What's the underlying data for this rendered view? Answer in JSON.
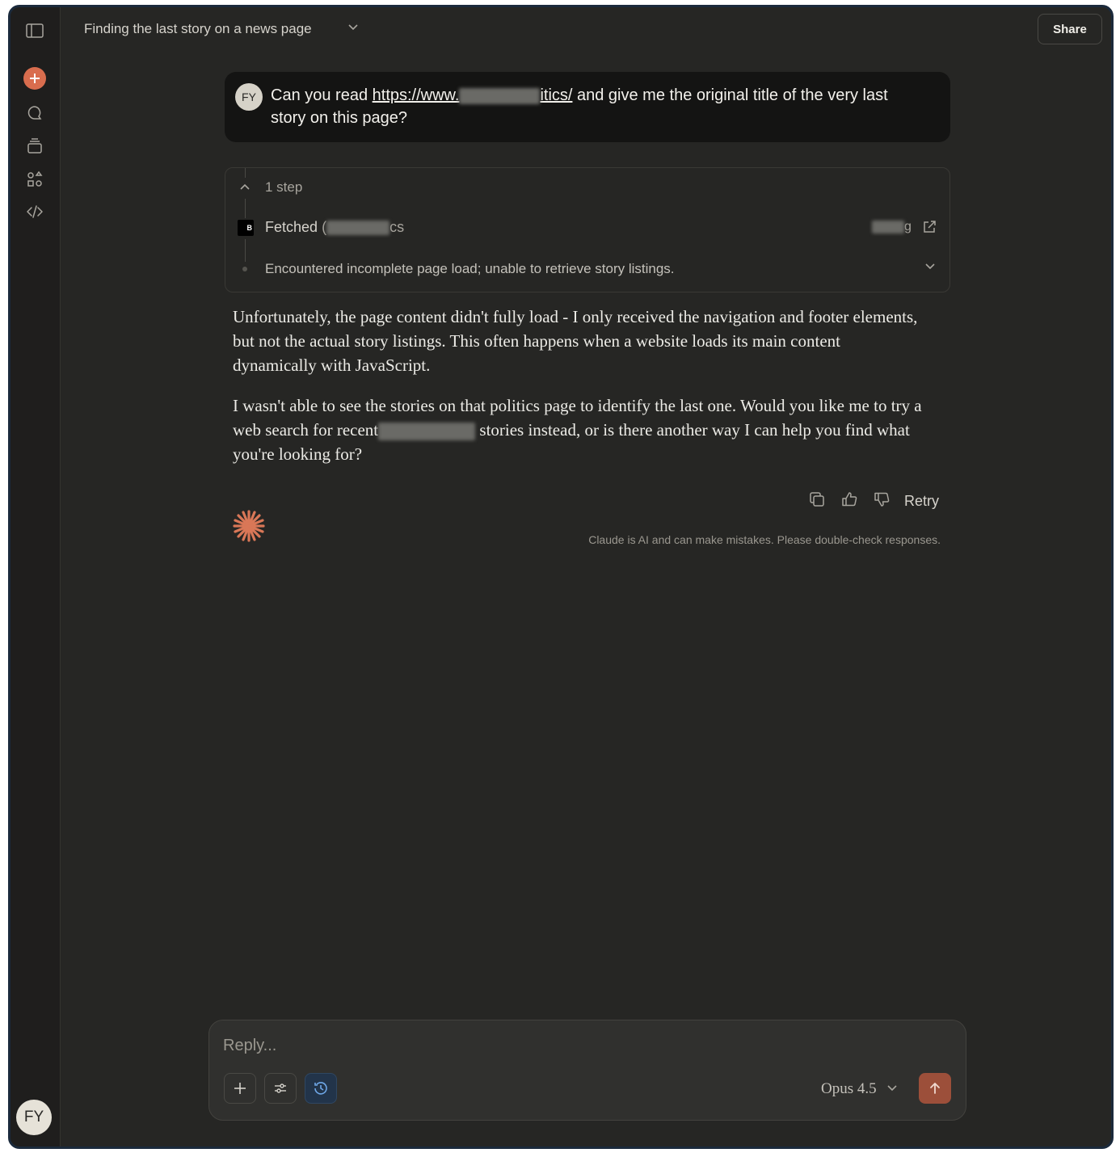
{
  "header": {
    "title": "Finding the last story on a news page",
    "share_label": "Share"
  },
  "sidebar": {
    "user_initials": "FY",
    "icons": [
      "sidebar-toggle-icon",
      "new-chat-icon",
      "chats-icon",
      "projects-icon",
      "artifacts-icon",
      "code-icon"
    ]
  },
  "user_message": {
    "initials": "FY",
    "text_before": "Can you read ",
    "link_start": "https://www.",
    "link_end": "itics/",
    "text_after": " and give me the original title of the very last story on this page?"
  },
  "steps": {
    "count_label": "1 step",
    "fetched_label": "Fetched",
    "fetched_partial_start": "(",
    "fetched_partial_end": "cs",
    "source_tail": "g",
    "favicon_text": "B",
    "summary": "Encountered incomplete page load; unable to retrieve story listings."
  },
  "assistant": {
    "paragraph1": "Unfortunately, the page content didn't fully load - I only received the navigation and footer elements, but not the actual story listings. This often happens when a website loads its main content dynamically with JavaScript.",
    "paragraph2_before": "I wasn't able to see the stories on that politics page to identify the last one. Would you like me to try a web search for recent",
    "paragraph2_after": " stories instead, or is there another way I can help you find what you're looking for?"
  },
  "actions": {
    "retry_label": "Retry",
    "disclaimer": "Claude is AI and can make mistakes. Please double-check responses."
  },
  "composer": {
    "placeholder": "Reply...",
    "model": "Opus 4.5"
  },
  "colors": {
    "accent": "#d96d4e",
    "background": "#262624",
    "sidebar": "#1f1e1d",
    "user_bubble": "#141413",
    "send_button": "#9c4f3a"
  }
}
